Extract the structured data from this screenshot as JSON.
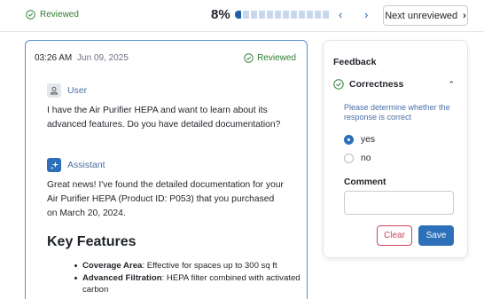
{
  "topbar": {
    "status_label": "Reviewed",
    "progress_text": "8%",
    "progress_value": 0.08,
    "prev_icon": "chevron-left-icon",
    "next_icon": "chevron-right-icon",
    "next_unreviewed_label": "Next unreviewed"
  },
  "conversation": {
    "time": "03:26 AM",
    "date": "Jun 09, 2025",
    "status_label": "Reviewed",
    "user": {
      "role": "User",
      "text": "I have the Air Purifier HEPA and want to learn about its advanced features. Do you have detailed documentation?"
    },
    "assistant": {
      "role": "Assistant",
      "text": "Great news! I've found the detailed documentation for your Air Purifier HEPA (Product ID: P053) that you purchased on March 20, 2024.",
      "heading": "Key Features",
      "features": [
        {
          "name": "Coverage Area",
          "desc": ": Effective for spaces up to 300 sq ft"
        },
        {
          "name": "Advanced Filtration",
          "desc": ": HEPA filter combined with activated carbon"
        }
      ]
    }
  },
  "feedback": {
    "title": "Feedback",
    "section": "Correctness",
    "description": "Please determine whether the response is correct",
    "options": [
      {
        "label": "yes",
        "selected": true
      },
      {
        "label": "no",
        "selected": false
      }
    ],
    "comment_label": "Comment",
    "comment_value": "",
    "clear_label": "Clear",
    "save_label": "Save"
  },
  "colors": {
    "accent": "#2d6fb8",
    "success": "#2e7d32",
    "danger": "#d1435b"
  }
}
